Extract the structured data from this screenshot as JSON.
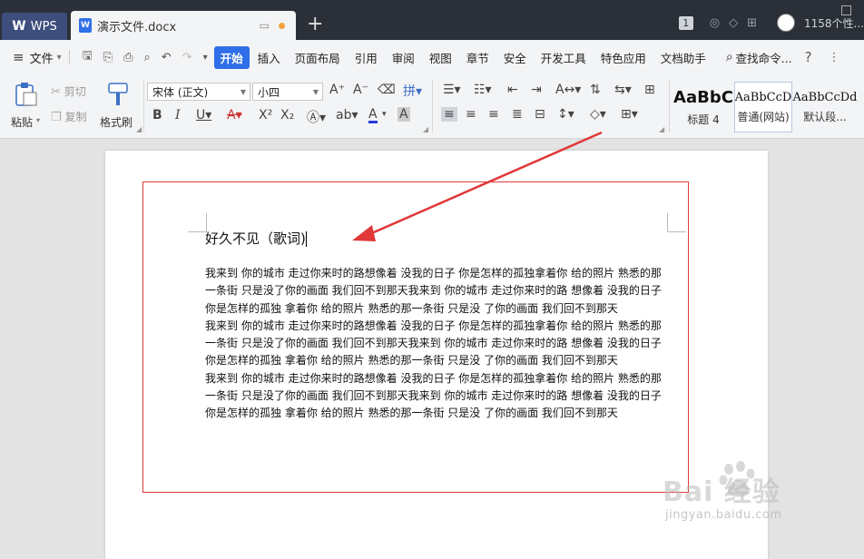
{
  "titlebar": {
    "app_tab": "WPS",
    "doc_tab": "演示文件.docx",
    "badge": "1",
    "user_text": "1158个性..."
  },
  "menubar": {
    "file": "文件",
    "items": [
      "开始",
      "插入",
      "页面布局",
      "引用",
      "审阅",
      "视图",
      "章节",
      "安全",
      "开发工具",
      "特色应用",
      "文档助手"
    ],
    "search": "查找命令..."
  },
  "ribbon": {
    "paste": "粘贴",
    "cut": "剪切",
    "copy": "复制",
    "format_painter": "格式刷",
    "font_name": "宋体 (正文)",
    "font_size": "小四",
    "styles": [
      {
        "sample": "AaBbC",
        "label": "标题 4"
      },
      {
        "sample": "AaBbCcD",
        "label": "普通(网站)"
      },
      {
        "sample": "AaBbCcDd",
        "label": "默认段..."
      }
    ]
  },
  "document": {
    "title": "好久不见（歌词)",
    "paragraphs": [
      "我来到 你的城市 走过你来时的路想像着 没我的日子 你是怎样的孤独拿着你 给的照片 熟悉的那一条街  只是没了你的画面 我们回不到那天我来到 你的城市 走过你来时的路  想像着 没我的日子 你是怎样的孤独  拿着你 给的照片 熟悉的那一条街  只是没 了你的画面 我们回不到那天",
      "我来到 你的城市 走过你来时的路想像着 没我的日子 你是怎样的孤独拿着你 给的照片 熟悉的那一条街  只是没了你的画面 我们回不到那天我来到 你的城市 走过你来时的路  想像着 没我的日子 你是怎样的孤独  拿着你 给的照片 熟悉的那一条街  只是没 了你的画面 我们回不到那天",
      "我来到 你的城市 走过你来时的路想像着 没我的日子 你是怎样的孤独拿着你 给的照片 熟悉的那一条街  只是没了你的画面 我们回不到那天我来到 你的城市 走过你来时的路  想像着 没我的日子 你是怎样的孤独  拿着你 给的照片 熟悉的那一条街  只是没 了你的画面 我们回不到那天"
    ]
  },
  "watermark": {
    "brand": "Bai 经验",
    "url": "jingyan.baidu.com"
  },
  "colors": {
    "accent": "#2f6fe8",
    "annotation": "#e03838",
    "titlebar": "#2b3038"
  }
}
